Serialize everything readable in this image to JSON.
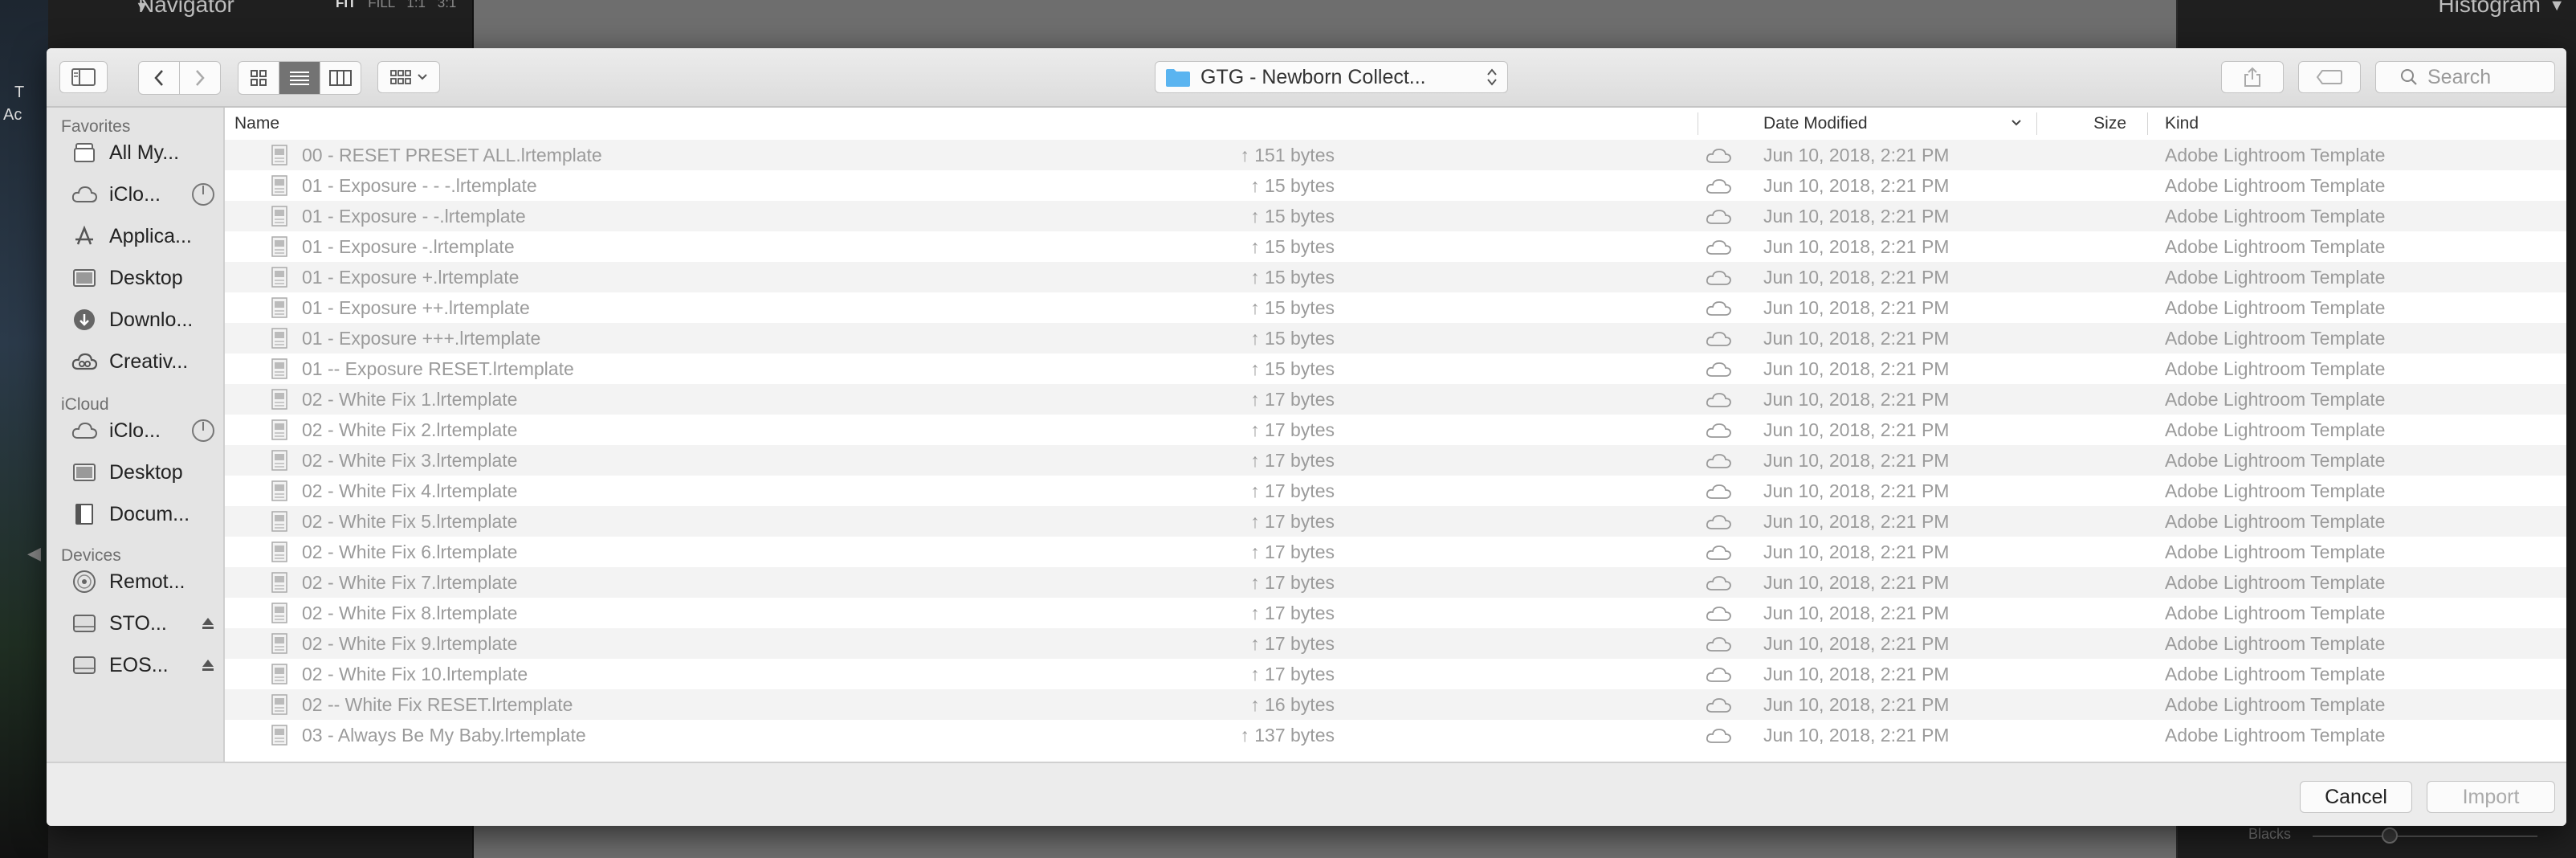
{
  "background": {
    "navigator_title": "Navigator",
    "navigator_options": [
      "FIT",
      "FILL",
      "1:1",
      "3:1"
    ],
    "histogram_title": "Histogram",
    "left_strip_text_1": "T",
    "left_strip_text_2": "Ac",
    "blacks_label": "Blacks"
  },
  "toolbar": {
    "location": "GTG - Newborn Collect...",
    "search_placeholder": "Search"
  },
  "sidebar": {
    "sections": [
      {
        "title": "Favorites",
        "items": [
          {
            "label": "All My...",
            "icon": "all-my-files-icon"
          },
          {
            "label": "iClo...",
            "icon": "cloud-icon",
            "extra": "progress-icon"
          },
          {
            "label": "Applica...",
            "icon": "applications-icon"
          },
          {
            "label": "Desktop",
            "icon": "desktop-icon"
          },
          {
            "label": "Downlo...",
            "icon": "downloads-icon"
          },
          {
            "label": "Creativ...",
            "icon": "creative-cloud-icon"
          }
        ]
      },
      {
        "title": "iCloud",
        "items": [
          {
            "label": "iClo...",
            "icon": "cloud-icon",
            "extra": "progress-icon"
          },
          {
            "label": "Desktop",
            "icon": "desktop-icon"
          },
          {
            "label": "Docum...",
            "icon": "document-icon"
          }
        ]
      },
      {
        "title": "Devices",
        "items": [
          {
            "label": "Remot...",
            "icon": "disc-icon"
          },
          {
            "label": "STO...",
            "icon": "drive-icon",
            "extra": "eject-icon"
          },
          {
            "label": "EOS...",
            "icon": "drive-icon",
            "extra": "eject-icon"
          }
        ]
      }
    ]
  },
  "columns": {
    "name": "Name",
    "date": "Date Modified",
    "size": "Size",
    "kind": "Kind"
  },
  "files": [
    {
      "name": "00 - RESET PRESET ALL.lrtemplate",
      "date": "Jun 10, 2018, 2:21 PM",
      "size": "151 bytes",
      "kind": "Adobe Lightroom Template"
    },
    {
      "name": "01 - Exposure  -  -  -.lrtemplate",
      "date": "Jun 10, 2018, 2:21 PM",
      "size": "15 bytes",
      "kind": "Adobe Lightroom Template"
    },
    {
      "name": "01 - Exposure  -  -.lrtemplate",
      "date": "Jun 10, 2018, 2:21 PM",
      "size": "15 bytes",
      "kind": "Adobe Lightroom Template"
    },
    {
      "name": "01 - Exposure  -.lrtemplate",
      "date": "Jun 10, 2018, 2:21 PM",
      "size": "15 bytes",
      "kind": "Adobe Lightroom Template"
    },
    {
      "name": "01 - Exposure  +.lrtemplate",
      "date": "Jun 10, 2018, 2:21 PM",
      "size": "15 bytes",
      "kind": "Adobe Lightroom Template"
    },
    {
      "name": "01 - Exposure  ++.lrtemplate",
      "date": "Jun 10, 2018, 2:21 PM",
      "size": "15 bytes",
      "kind": "Adobe Lightroom Template"
    },
    {
      "name": "01 - Exposure  +++.lrtemplate",
      "date": "Jun 10, 2018, 2:21 PM",
      "size": "15 bytes",
      "kind": "Adobe Lightroom Template"
    },
    {
      "name": "01 -- Exposure RESET.lrtemplate",
      "date": "Jun 10, 2018, 2:21 PM",
      "size": "15 bytes",
      "kind": "Adobe Lightroom Template"
    },
    {
      "name": "02 - White Fix 1.lrtemplate",
      "date": "Jun 10, 2018, 2:21 PM",
      "size": "17 bytes",
      "kind": "Adobe Lightroom Template"
    },
    {
      "name": "02 - White Fix 2.lrtemplate",
      "date": "Jun 10, 2018, 2:21 PM",
      "size": "17 bytes",
      "kind": "Adobe Lightroom Template"
    },
    {
      "name": "02 - White Fix 3.lrtemplate",
      "date": "Jun 10, 2018, 2:21 PM",
      "size": "17 bytes",
      "kind": "Adobe Lightroom Template"
    },
    {
      "name": "02 - White Fix 4.lrtemplate",
      "date": "Jun 10, 2018, 2:21 PM",
      "size": "17 bytes",
      "kind": "Adobe Lightroom Template"
    },
    {
      "name": "02 - White Fix 5.lrtemplate",
      "date": "Jun 10, 2018, 2:21 PM",
      "size": "17 bytes",
      "kind": "Adobe Lightroom Template"
    },
    {
      "name": "02 - White Fix 6.lrtemplate",
      "date": "Jun 10, 2018, 2:21 PM",
      "size": "17 bytes",
      "kind": "Adobe Lightroom Template"
    },
    {
      "name": "02 - White Fix 7.lrtemplate",
      "date": "Jun 10, 2018, 2:21 PM",
      "size": "17 bytes",
      "kind": "Adobe Lightroom Template"
    },
    {
      "name": "02 - White Fix 8.lrtemplate",
      "date": "Jun 10, 2018, 2:21 PM",
      "size": "17 bytes",
      "kind": "Adobe Lightroom Template"
    },
    {
      "name": "02 - White Fix 9.lrtemplate",
      "date": "Jun 10, 2018, 2:21 PM",
      "size": "17 bytes",
      "kind": "Adobe Lightroom Template"
    },
    {
      "name": "02 - White Fix 10.lrtemplate",
      "date": "Jun 10, 2018, 2:21 PM",
      "size": "17 bytes",
      "kind": "Adobe Lightroom Template"
    },
    {
      "name": "02 -- White Fix RESET.lrtemplate",
      "date": "Jun 10, 2018, 2:21 PM",
      "size": "16 bytes",
      "kind": "Adobe Lightroom Template"
    },
    {
      "name": "03 - Always Be My Baby.lrtemplate",
      "date": "Jun 10, 2018, 2:21 PM",
      "size": "137 bytes",
      "kind": "Adobe Lightroom Template"
    }
  ],
  "footer": {
    "cancel_label": "Cancel",
    "import_label": "Import"
  },
  "colors": {
    "active_segment": "#737373",
    "folder_blue": "#5ab4f0",
    "dimmed_text": "#9b9b9b"
  }
}
